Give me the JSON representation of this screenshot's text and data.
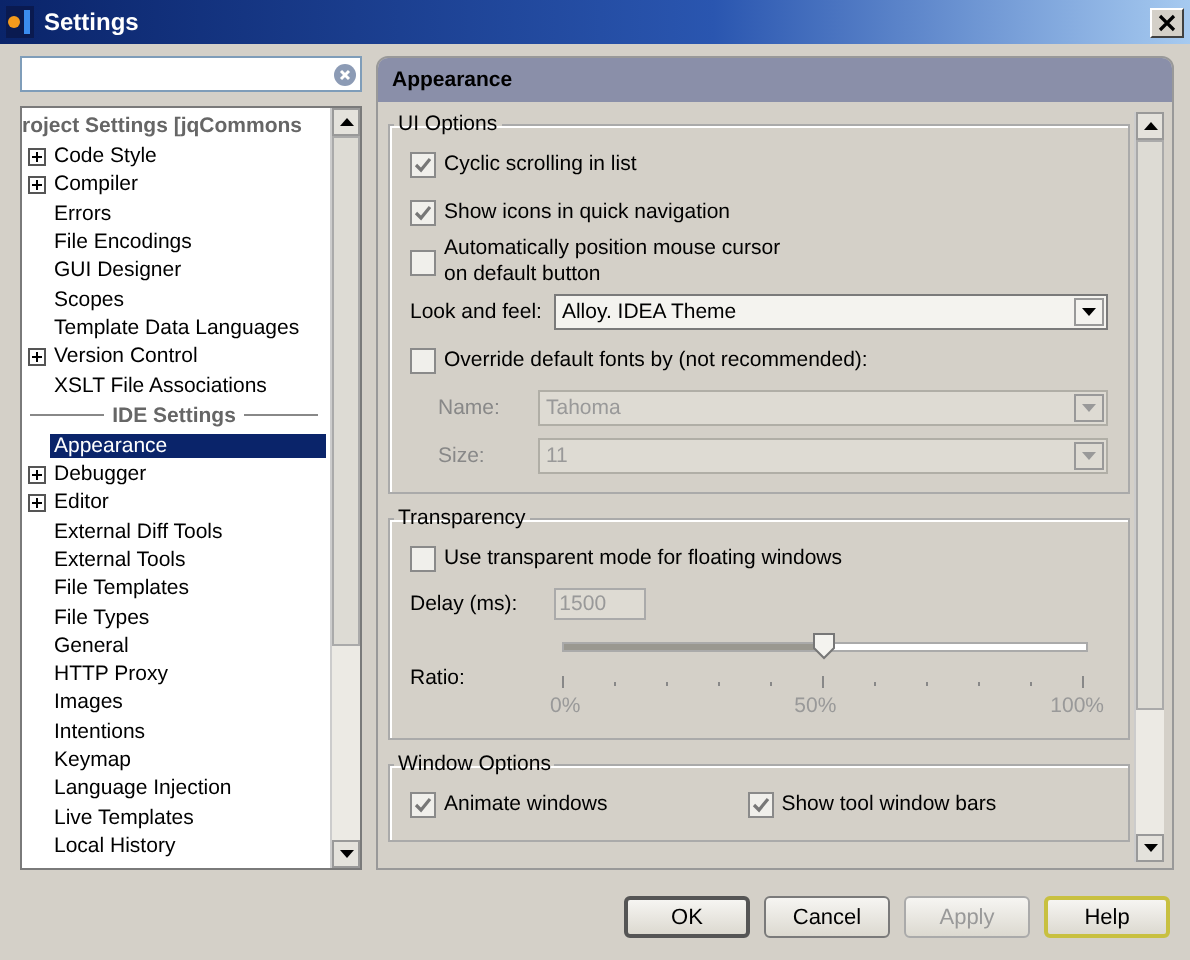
{
  "window": {
    "title": "Settings"
  },
  "tree": {
    "sections": [
      {
        "title": "roject Settings [jqCommons",
        "items": [
          {
            "label": "Code Style",
            "kind": "group",
            "selected": false
          },
          {
            "label": "Compiler",
            "kind": "group",
            "selected": false
          },
          {
            "label": "Errors",
            "kind": "leaf",
            "selected": false
          },
          {
            "label": "File Encodings",
            "kind": "leaf",
            "selected": false
          },
          {
            "label": "GUI Designer",
            "kind": "leaf",
            "selected": false
          },
          {
            "label": "Scopes",
            "kind": "leaf",
            "selected": false
          },
          {
            "label": "Template Data Languages",
            "kind": "leaf",
            "selected": false
          },
          {
            "label": "Version Control",
            "kind": "group",
            "selected": false
          },
          {
            "label": "XSLT File Associations",
            "kind": "leaf",
            "selected": false
          }
        ]
      },
      {
        "title": "IDE Settings",
        "items": [
          {
            "label": "Appearance",
            "kind": "leaf",
            "selected": true
          },
          {
            "label": "Debugger",
            "kind": "group",
            "selected": false
          },
          {
            "label": "Editor",
            "kind": "group",
            "selected": false
          },
          {
            "label": "External Diff Tools",
            "kind": "leaf",
            "selected": false
          },
          {
            "label": "External Tools",
            "kind": "leaf",
            "selected": false
          },
          {
            "label": "File Templates",
            "kind": "leaf",
            "selected": false
          },
          {
            "label": "File Types",
            "kind": "leaf",
            "selected": false
          },
          {
            "label": "General",
            "kind": "leaf",
            "selected": false
          },
          {
            "label": "HTTP Proxy",
            "kind": "leaf",
            "selected": false
          },
          {
            "label": "Images",
            "kind": "leaf",
            "selected": false
          },
          {
            "label": "Intentions",
            "kind": "leaf",
            "selected": false
          },
          {
            "label": "Keymap",
            "kind": "leaf",
            "selected": false
          },
          {
            "label": "Language Injection",
            "kind": "leaf",
            "selected": false
          },
          {
            "label": "Live Templates",
            "kind": "leaf",
            "selected": false
          },
          {
            "label": "Local History",
            "kind": "leaf",
            "selected": false
          }
        ]
      }
    ]
  },
  "panel": {
    "title": "Appearance",
    "groups": [
      {
        "title": "UI Options",
        "rows": [
          {
            "kind": "checkbox",
            "label": "Cyclic scrolling in list",
            "checked": true
          },
          {
            "kind": "checkbox",
            "label": "Show icons in quick navigation",
            "checked": true
          },
          {
            "kind": "checkbox",
            "label": "Automatically position mouse cursor\non default button",
            "checked": false
          },
          {
            "kind": "combo",
            "label": "Look and feel:",
            "value": "Alloy. IDEA Theme",
            "disabled": false
          },
          {
            "kind": "checkbox",
            "label": "Override default fonts by (not recommended):",
            "checked": false
          },
          {
            "kind": "subcombo",
            "label": "Name:",
            "value": "Tahoma",
            "disabled": true
          },
          {
            "kind": "subcombo",
            "label": "Size:",
            "value": "11",
            "disabled": true
          }
        ]
      },
      {
        "title": "Transparency",
        "rows": [
          {
            "kind": "checkbox",
            "label": "Use transparent mode for floating windows",
            "checked": false
          },
          {
            "kind": "textfield",
            "label": "Delay (ms):",
            "value": "1500",
            "disabled": true
          },
          {
            "kind": "slider",
            "label": "Ratio:",
            "level": 0.5,
            "tick_labels": [
              "0%",
              "50%",
              "100%"
            ]
          }
        ]
      },
      {
        "title": "Window Options",
        "rows": [
          {
            "kind": "checkbox_pair",
            "checkboxes": [
              {
                "label": "Animate windows",
                "checked": true
              },
              {
                "label": "Show tool window bars",
                "checked": true
              }
            ]
          }
        ]
      }
    ]
  },
  "buttons": [
    {
      "label": "OK",
      "kind": "default",
      "disabled": false
    },
    {
      "label": "Cancel",
      "kind": "normal",
      "disabled": false
    },
    {
      "label": "Apply",
      "kind": "normal",
      "disabled": true
    },
    {
      "label": "Help",
      "kind": "focused",
      "disabled": false
    }
  ]
}
